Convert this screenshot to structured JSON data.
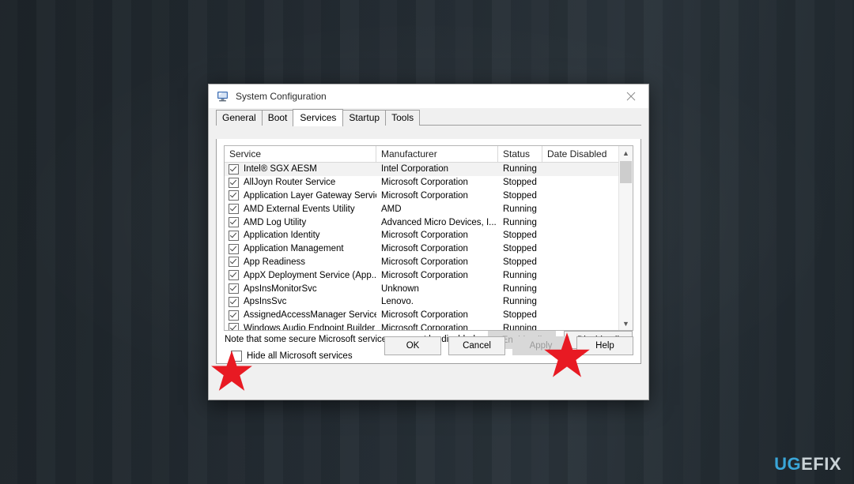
{
  "desktop": {
    "watermark": {
      "part1": "UG",
      "part2": "E",
      "part3": "FIX"
    }
  },
  "dialog": {
    "title": "System Configuration",
    "icon": "system-configuration-icon",
    "close_label": "✕",
    "tabs": [
      {
        "label": "General",
        "active": false
      },
      {
        "label": "Boot",
        "active": false
      },
      {
        "label": "Services",
        "active": true
      },
      {
        "label": "Startup",
        "active": false
      },
      {
        "label": "Tools",
        "active": false
      }
    ],
    "table": {
      "columns": [
        "Service",
        "Manufacturer",
        "Status",
        "Date Disabled"
      ],
      "rows": [
        {
          "checked": true,
          "service": "Intel® SGX AESM",
          "manufacturer": "Intel Corporation",
          "status": "Running",
          "date_disabled": "",
          "selected": true
        },
        {
          "checked": true,
          "service": "AllJoyn Router Service",
          "manufacturer": "Microsoft Corporation",
          "status": "Stopped",
          "date_disabled": "",
          "selected": false
        },
        {
          "checked": true,
          "service": "Application Layer Gateway Service",
          "manufacturer": "Microsoft Corporation",
          "status": "Stopped",
          "date_disabled": "",
          "selected": false
        },
        {
          "checked": true,
          "service": "AMD External Events Utility",
          "manufacturer": "AMD",
          "status": "Running",
          "date_disabled": "",
          "selected": false
        },
        {
          "checked": true,
          "service": "AMD Log Utility",
          "manufacturer": "Advanced Micro Devices, I...",
          "status": "Running",
          "date_disabled": "",
          "selected": false
        },
        {
          "checked": true,
          "service": "Application Identity",
          "manufacturer": "Microsoft Corporation",
          "status": "Stopped",
          "date_disabled": "",
          "selected": false
        },
        {
          "checked": true,
          "service": "Application Management",
          "manufacturer": "Microsoft Corporation",
          "status": "Stopped",
          "date_disabled": "",
          "selected": false
        },
        {
          "checked": true,
          "service": "App Readiness",
          "manufacturer": "Microsoft Corporation",
          "status": "Stopped",
          "date_disabled": "",
          "selected": false
        },
        {
          "checked": true,
          "service": "AppX Deployment Service (App...",
          "manufacturer": "Microsoft Corporation",
          "status": "Running",
          "date_disabled": "",
          "selected": false
        },
        {
          "checked": true,
          "service": "ApsInsMonitorSvc",
          "manufacturer": "Unknown",
          "status": "Running",
          "date_disabled": "",
          "selected": false
        },
        {
          "checked": true,
          "service": "ApsInsSvc",
          "manufacturer": "Lenovo.",
          "status": "Running",
          "date_disabled": "",
          "selected": false
        },
        {
          "checked": true,
          "service": "AssignedAccessManager Service",
          "manufacturer": "Microsoft Corporation",
          "status": "Stopped",
          "date_disabled": "",
          "selected": false
        },
        {
          "checked": true,
          "service": "Windows Audio Endpoint Builder",
          "manufacturer": "Microsoft Corporation",
          "status": "Running",
          "date_disabled": "",
          "selected": false
        }
      ]
    },
    "note": "Note that some secure Microsoft services may not be disabled.",
    "hide_ms_services": {
      "label": "Hide all Microsoft services",
      "checked": false
    },
    "enable_all": {
      "label": "Enable all",
      "disabled": true
    },
    "disable_all": {
      "label": "Disable all",
      "disabled": false
    },
    "footer": [
      {
        "label": "OK",
        "disabled": false
      },
      {
        "label": "Cancel",
        "disabled": false
      },
      {
        "label": "Apply",
        "disabled": true
      },
      {
        "label": "Help",
        "disabled": false
      }
    ]
  },
  "annotations": {
    "color": "#e81a23",
    "markers": [
      {
        "name": "star-marker-disable-all"
      },
      {
        "name": "star-marker-hide-microsoft-services"
      }
    ]
  }
}
